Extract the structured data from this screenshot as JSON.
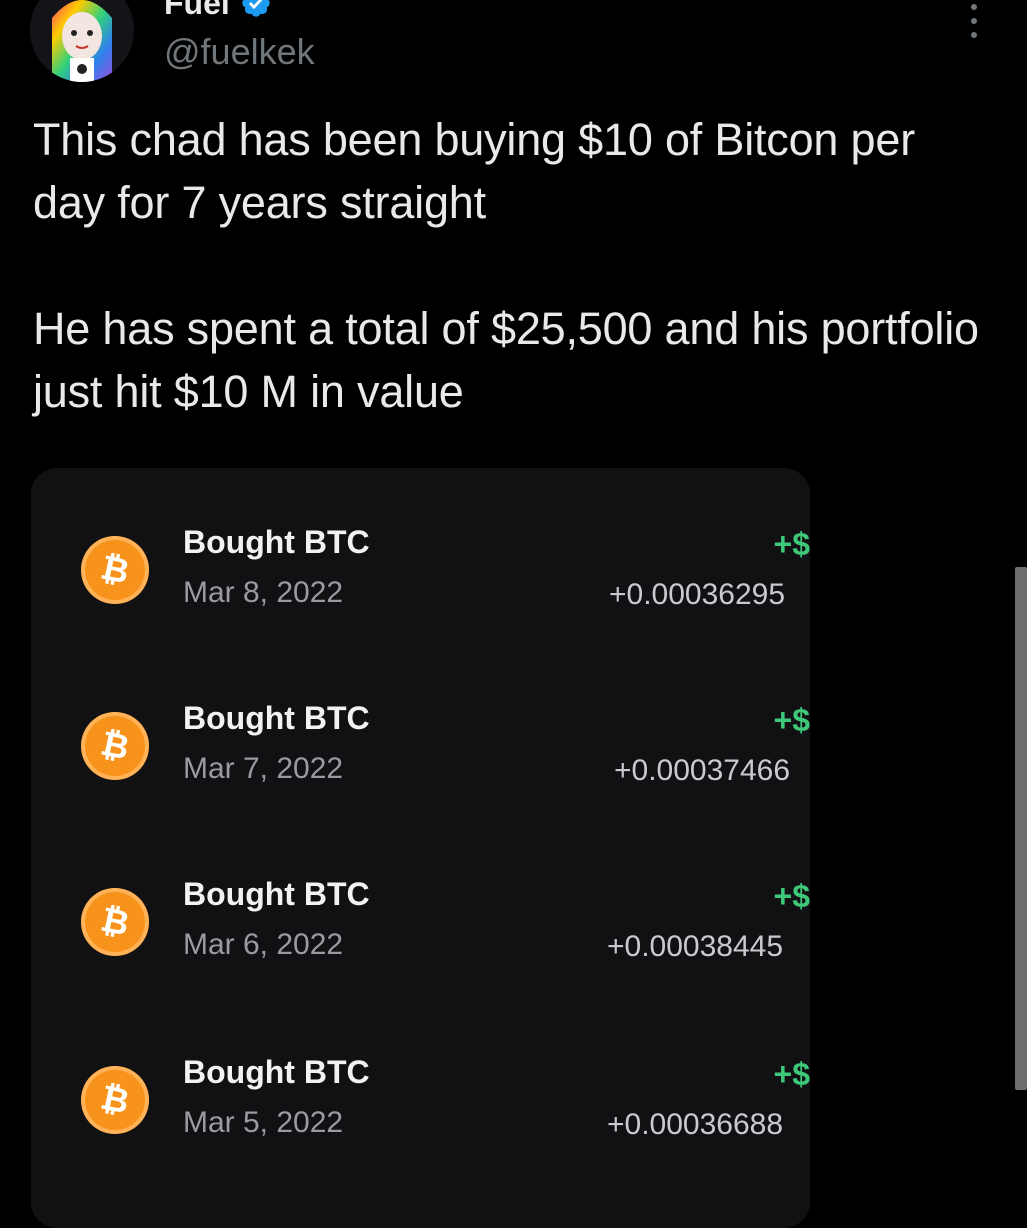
{
  "tweet": {
    "author": {
      "display_name": "Fuel",
      "handle": "@fuelkek",
      "verified": true,
      "verified_color": "#1d9bf0"
    },
    "more_icon": "more-vertical-icon",
    "paragraphs": [
      "This chad has been buying $10 of Bitcon per day for 7 years straight",
      "He has spent a total of $25,500 and his portfolio just hit $10 M in value"
    ]
  },
  "media": {
    "accent_color": "#f7931a",
    "positive_color": "#3ec97a",
    "coin_icon": "bitcoin-icon",
    "transactions": [
      {
        "title": "Bought BTC",
        "date": "Mar 8, 2022",
        "usd": "+$",
        "btc": "+0.00036295"
      },
      {
        "title": "Bought BTC",
        "date": "Mar 7, 2022",
        "usd": "+$",
        "btc": "+0.00037466"
      },
      {
        "title": "Bought BTC",
        "date": "Mar 6, 2022",
        "usd": "+$",
        "btc": "+0.00038445"
      },
      {
        "title": "Bought BTC",
        "date": "Mar 5, 2022",
        "usd": "+$",
        "btc": "+0.00036688"
      }
    ]
  }
}
